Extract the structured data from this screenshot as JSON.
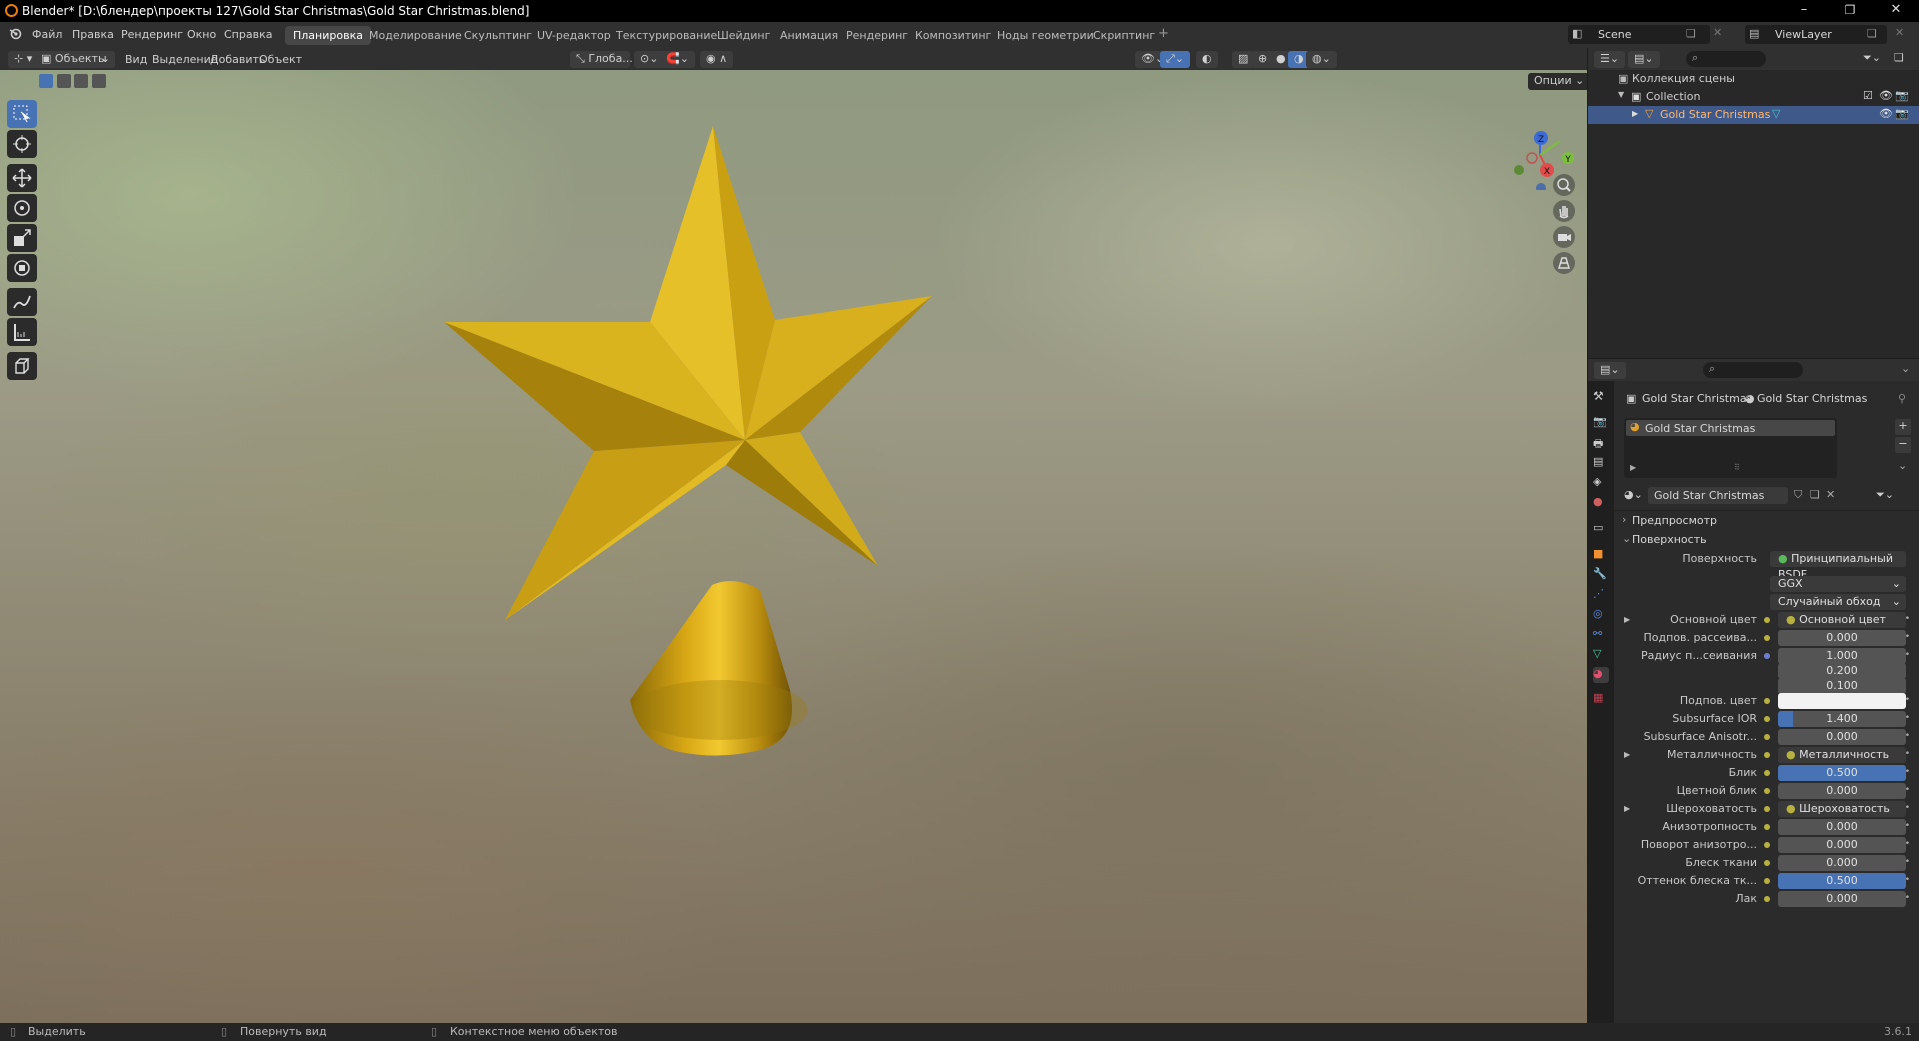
{
  "window": {
    "title": "Blender* [D:\\блендер\\проекты 127\\Gold Star Christmas\\Gold Star Christmas.blend]",
    "minimize": "–",
    "maximize": "❐",
    "close": "✕"
  },
  "menu": [
    "Файл",
    "Правка",
    "Рендеринг",
    "Окно",
    "Справка"
  ],
  "workspaces": [
    "Планировка",
    "Моделирование",
    "Скульптинг",
    "UV-редактор",
    "Текстурирование",
    "Шейдинг",
    "Анимация",
    "Рендеринг",
    "Композитинг",
    "Ноды геометрии",
    "Скриптинг"
  ],
  "active_workspace": "Планировка",
  "scene_name": "Scene",
  "view_layer": "ViewLayer",
  "viewport_header": {
    "mode": "Объекты",
    "menus": [
      "Вид",
      "Выделение",
      "Добавить",
      "Объект"
    ],
    "transform": "Глоба...",
    "options": "Опции"
  },
  "gizmo": {
    "x": "X",
    "y": "Y",
    "z": "Z"
  },
  "outliner": {
    "root": "Коллекция сцены",
    "collection": "Collection",
    "object": "Gold Star Christmas"
  },
  "properties": {
    "breadcrumb_object": "Gold Star Christmas",
    "breadcrumb_material": "Gold Star Christmas",
    "slot_name": "Gold Star Christmas",
    "material_name": "Gold Star Christmas",
    "panel_preview": "Предпросмотр",
    "panel_surface": "Поверхность",
    "surface_label": "Поверхность",
    "surface_value": "Принципиальный BSDF",
    "distribution": "GGX",
    "subsurface_method": "Случайный обход",
    "rows": [
      {
        "label": "Основной цвет",
        "value": "Основной цвет",
        "type": "link",
        "expand": true
      },
      {
        "label": "Подпов. рассеива...",
        "value": "0.000",
        "type": "num",
        "fill": 0
      },
      {
        "label": "Радиус п...сеивания",
        "value": "1.000",
        "type": "num",
        "fill": 0,
        "dot": "blue"
      },
      {
        "label": "",
        "value": "0.200",
        "type": "num",
        "fill": 0,
        "nodot": true
      },
      {
        "label": "",
        "value": "0.100",
        "type": "num",
        "fill": 0,
        "nodot": true
      },
      {
        "label": "Подпов. цвет",
        "value": "",
        "type": "color"
      },
      {
        "label": "Subsurface IOR",
        "value": "1.400",
        "type": "num",
        "fill": 0.12
      },
      {
        "label": "Subsurface Anisotr...",
        "value": "0.000",
        "type": "num",
        "fill": 0
      },
      {
        "label": "Металличность",
        "value": "Металличность",
        "type": "link",
        "expand": true
      },
      {
        "label": "Блик",
        "value": "0.500",
        "type": "num",
        "fill": 1.0
      },
      {
        "label": "Цветной блик",
        "value": "0.000",
        "type": "num",
        "fill": 0
      },
      {
        "label": "Шероховатость",
        "value": "Шероховатость",
        "type": "link",
        "expand": true
      },
      {
        "label": "Анизотропность",
        "value": "0.000",
        "type": "num",
        "fill": 0
      },
      {
        "label": "Поворот анизотро...",
        "value": "0.000",
        "type": "num",
        "fill": 0
      },
      {
        "label": "Блеск ткани",
        "value": "0.000",
        "type": "num",
        "fill": 0
      },
      {
        "label": "Оттенок блеска тк...",
        "value": "0.500",
        "type": "num",
        "fill": 1.0
      },
      {
        "label": "Лак",
        "value": "0.000",
        "type": "num",
        "fill": 0
      }
    ]
  },
  "status": {
    "select": "Выделить",
    "rotate": "Повернуть вид",
    "context": "Контекстное меню объектов",
    "version": "3.6.1"
  }
}
